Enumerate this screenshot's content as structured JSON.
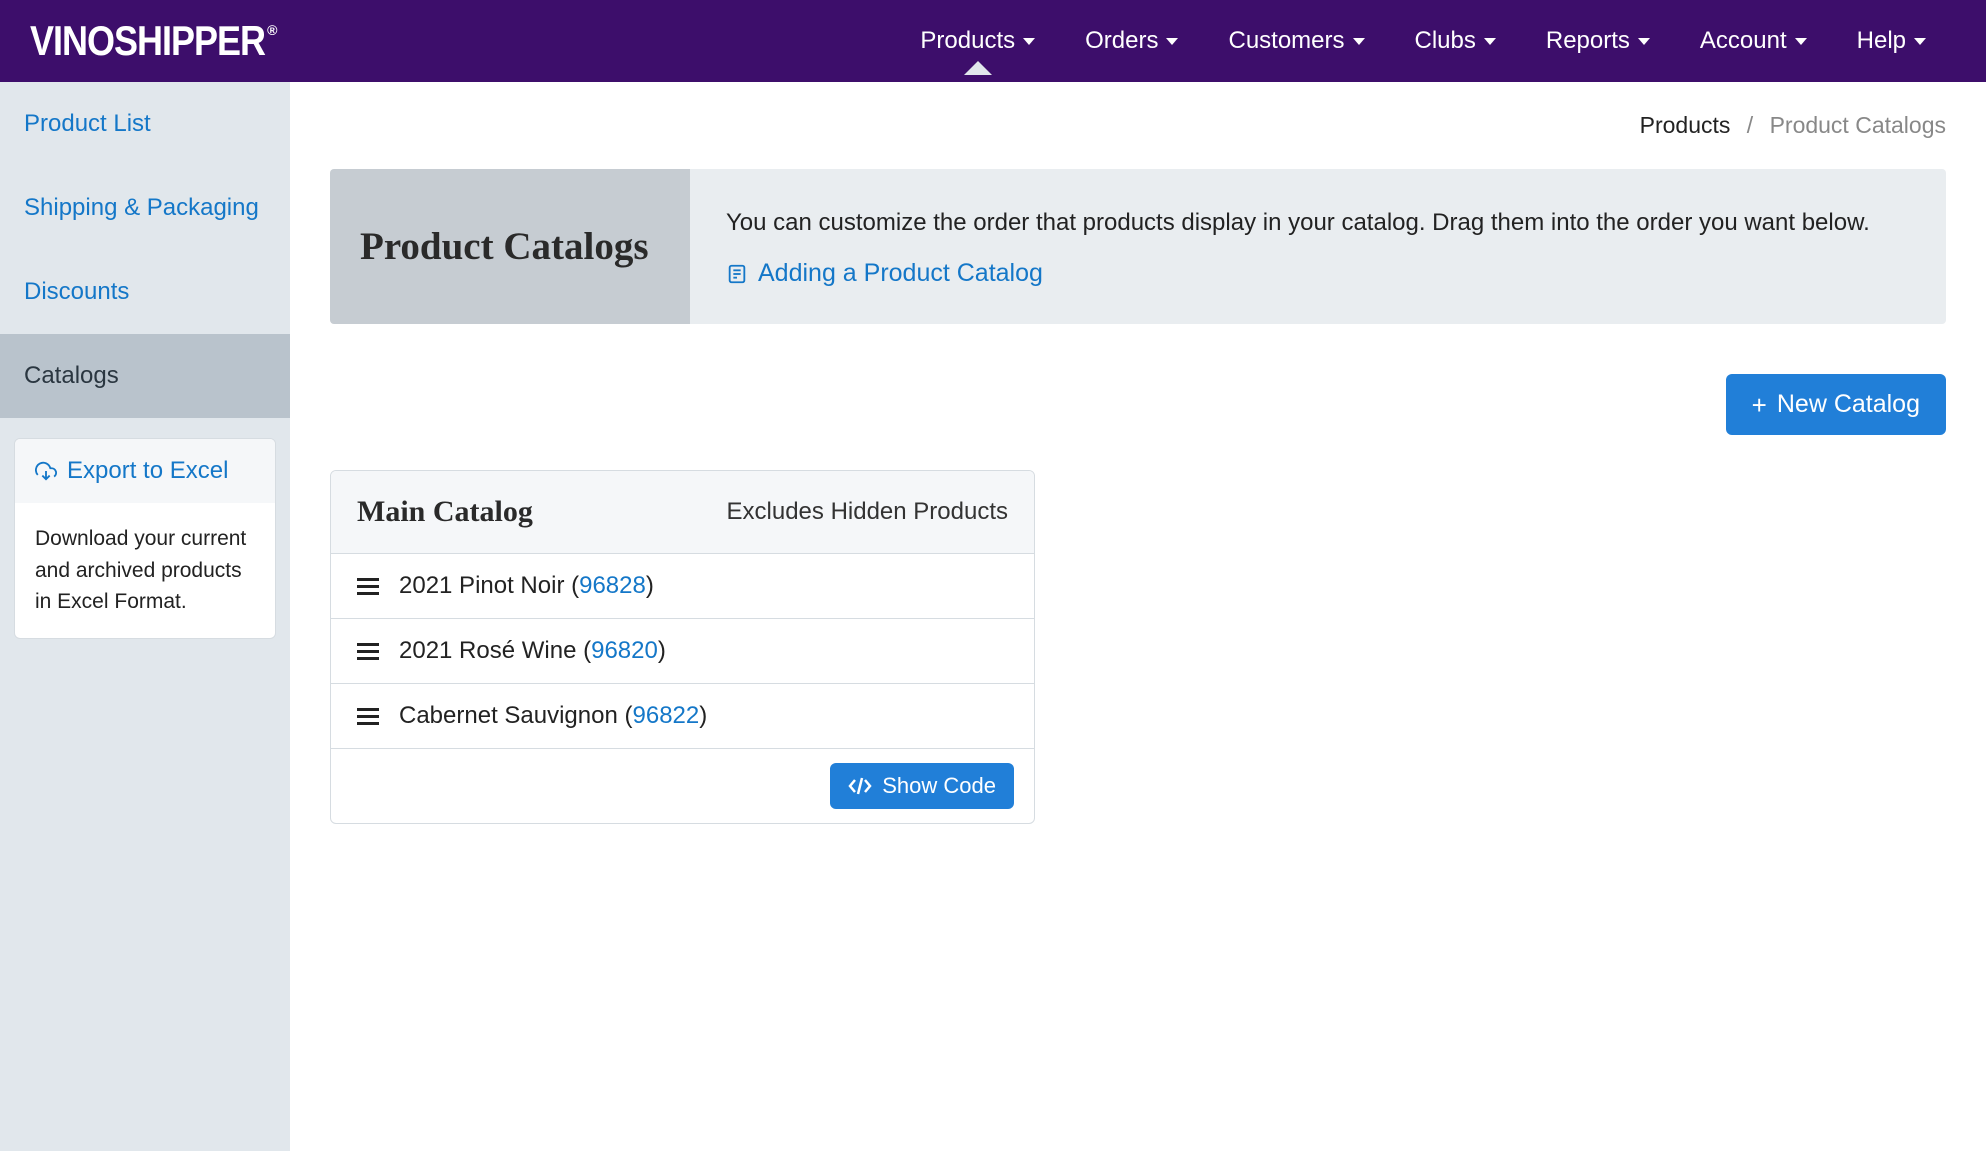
{
  "brand": "VINOSHIPPER",
  "nav": [
    {
      "label": "Products",
      "active": true
    },
    {
      "label": "Orders",
      "active": false
    },
    {
      "label": "Customers",
      "active": false
    },
    {
      "label": "Clubs",
      "active": false
    },
    {
      "label": "Reports",
      "active": false
    },
    {
      "label": "Account",
      "active": false
    },
    {
      "label": "Help",
      "active": false
    }
  ],
  "sidebar": {
    "items": [
      {
        "label": "Product List",
        "active": false
      },
      {
        "label": "Shipping & Packaging",
        "active": false
      },
      {
        "label": "Discounts",
        "active": false
      },
      {
        "label": "Catalogs",
        "active": true
      }
    ],
    "export": {
      "title": "Export to Excel",
      "body": "Download your current and archived products in Excel Format."
    }
  },
  "breadcrumb": {
    "parent": "Products",
    "current": "Product Catalogs"
  },
  "hero": {
    "title": "Product Catalogs",
    "desc": "You can customize the order that products display in your catalog. Drag them into the order you want below.",
    "link": "Adding a Product Catalog"
  },
  "new_catalog_btn": "New Catalog",
  "catalog": {
    "title": "Main Catalog",
    "note": "Excludes Hidden Products",
    "items": [
      {
        "name": "2021 Pinot Noir",
        "id": "96828"
      },
      {
        "name": "2021 Rosé Wine",
        "id": "96820"
      },
      {
        "name": "Cabernet Sauvignon",
        "id": "96822"
      }
    ],
    "show_code": "Show Code"
  }
}
